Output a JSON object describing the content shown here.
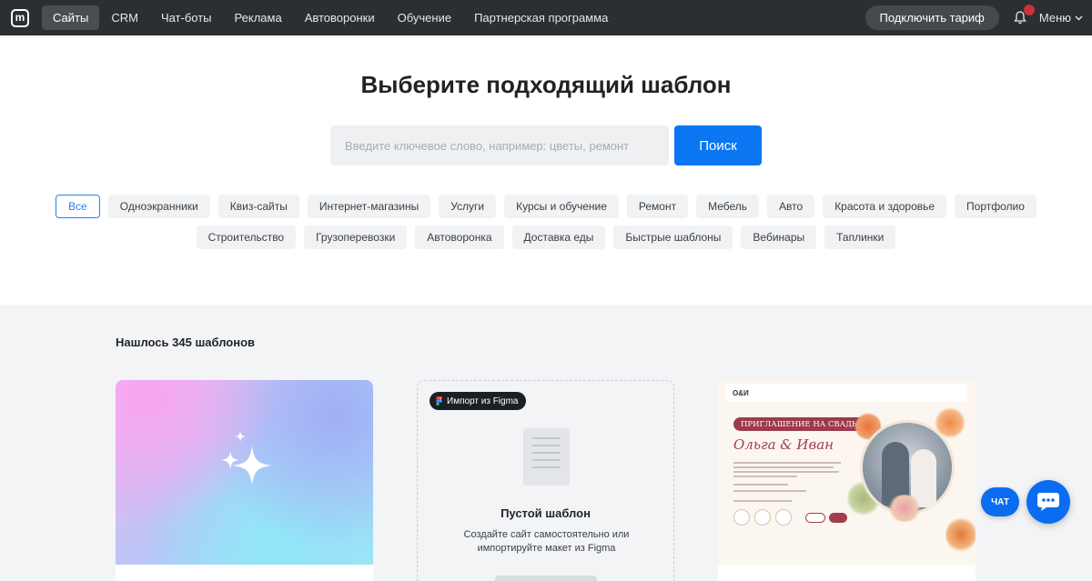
{
  "topbar": {
    "logo_letter": "m",
    "nav": [
      {
        "label": "Сайты",
        "active": true
      },
      {
        "label": "CRM",
        "active": false
      },
      {
        "label": "Чат-боты",
        "active": false
      },
      {
        "label": "Реклама",
        "active": false
      },
      {
        "label": "Автоворонки",
        "active": false
      },
      {
        "label": "Обучение",
        "active": false
      },
      {
        "label": "Партнерская программа",
        "active": false
      }
    ],
    "plan_button": "Подключить тариф",
    "menu_label": "Меню"
  },
  "hero": {
    "title": "Выберите подходящий шаблон",
    "search_placeholder": "Введите ключевое слово, например: цветы, ремонт",
    "search_button": "Поиск"
  },
  "categories": [
    {
      "label": "Все",
      "active": true
    },
    {
      "label": "Одноэкранники"
    },
    {
      "label": "Квиз-сайты"
    },
    {
      "label": "Интернет-магазины"
    },
    {
      "label": "Услуги"
    },
    {
      "label": "Курсы и обучение"
    },
    {
      "label": "Ремонт"
    },
    {
      "label": "Мебель"
    },
    {
      "label": "Авто"
    },
    {
      "label": "Красота и здоровье"
    },
    {
      "label": "Портфолио"
    },
    {
      "label": "Строительство"
    },
    {
      "label": "Грузоперевозки"
    },
    {
      "label": "Автоворонка"
    },
    {
      "label": "Доставка еды"
    },
    {
      "label": "Быстрые шаблоны"
    },
    {
      "label": "Вебинары"
    },
    {
      "label": "Таплинки"
    }
  ],
  "results": {
    "count_text": "Нашлось 345 шаблонов",
    "blank_card": {
      "badge": "Импорт из Figma",
      "title": "Пустой шаблон",
      "description": "Создайте сайт самостоятельно или импортируйте макет из Figma"
    },
    "wedding_card": {
      "ribbon": "ПРИГЛАШЕНИЕ НА СВАДЬБУ",
      "names": "Ольга & Иван"
    }
  },
  "chat": {
    "pill_label": "ЧАТ"
  },
  "colors": {
    "accent": "#0a76f2",
    "topbar_bg": "#2b2e32",
    "results_bg": "#f3f4f6"
  }
}
